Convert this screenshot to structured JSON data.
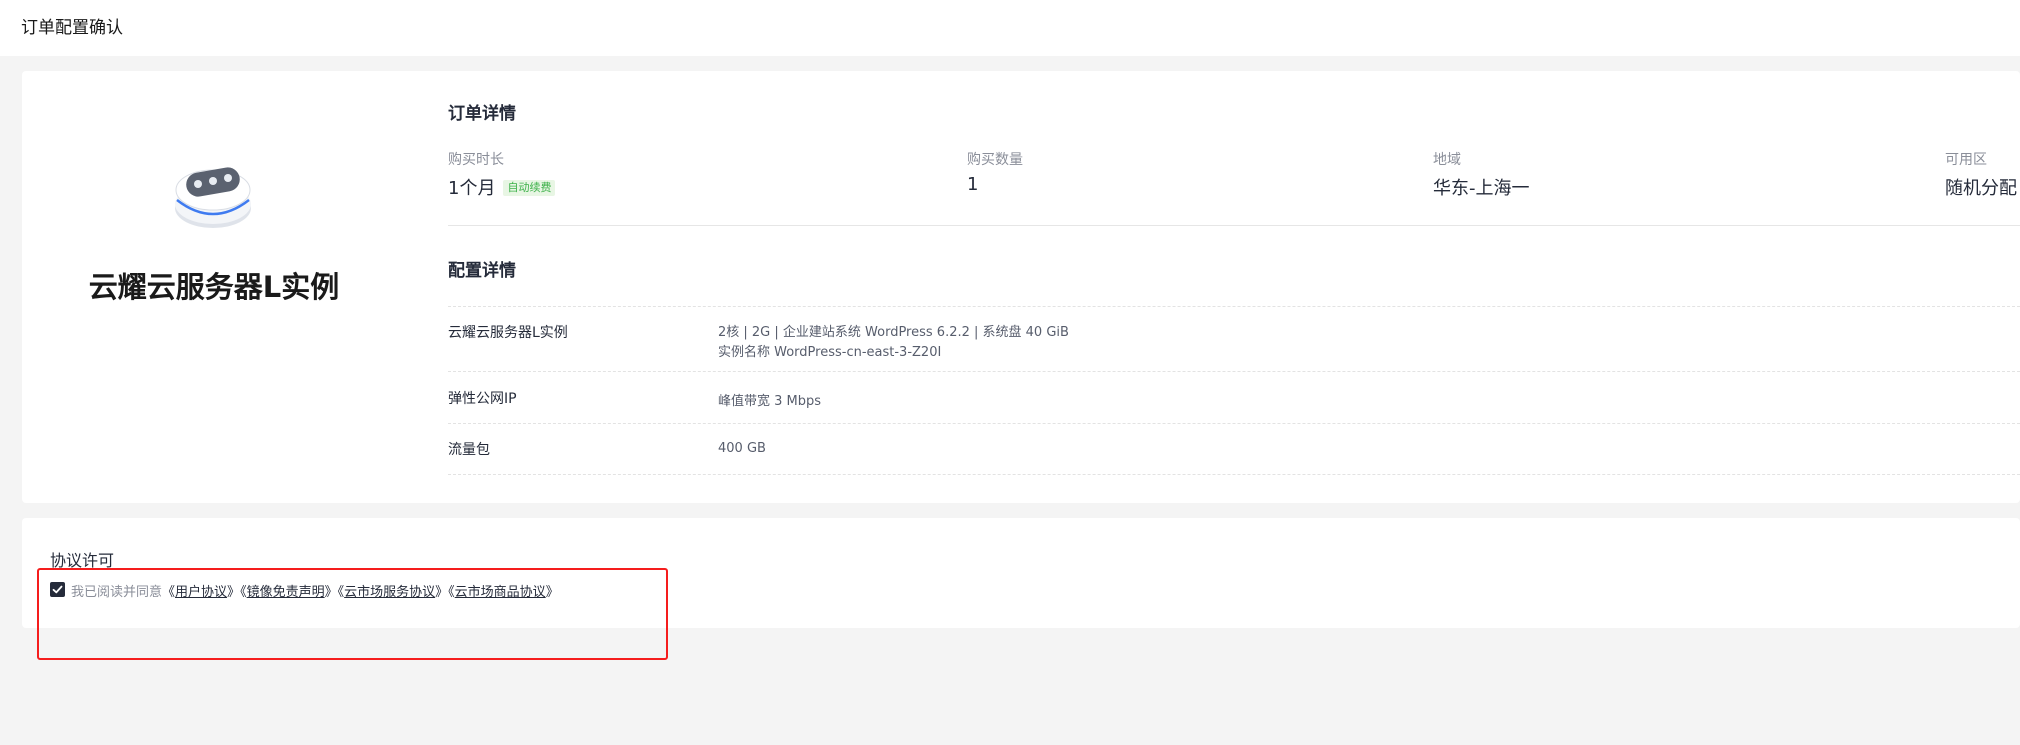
{
  "page": {
    "title": "订单配置确认"
  },
  "product": {
    "name": "云耀云服务器L实例",
    "icon": "server-box-icon"
  },
  "order": {
    "section_title": "订单详情",
    "duration_label": "购买时长",
    "duration_value": "1个月",
    "auto_renew_badge": "自动续费",
    "quantity_label": "购买数量",
    "quantity_value": "1",
    "region_label": "地域",
    "region_value": "华东-上海一",
    "zone_label": "可用区",
    "zone_value": "随机分配"
  },
  "config": {
    "section_title": "配置详情",
    "rows": [
      {
        "name": "云耀云服务器L实例",
        "line1": "2核 | 2G | 企业建站系统 WordPress 6.2.2 | 系统盘 40 GiB",
        "line2": "实例名称 WordPress-cn-east-3-Z20I"
      },
      {
        "name": "弹性公网IP",
        "line1": "峰值带宽 3 Mbps"
      },
      {
        "name": "流量包",
        "line1": "400 GB"
      }
    ]
  },
  "agreement": {
    "title": "协议许可",
    "checked": true,
    "prefix": "我已阅读并同意",
    "links": [
      "用户协议",
      "镜像免责声明",
      "云市场服务协议",
      "云市场商品协议"
    ],
    "open_bracket": "《",
    "close_bracket": "》"
  },
  "colors": {
    "highlight": "#f51d1d",
    "badge_text": "#3eb14a",
    "badge_bg": "#e8f6e4",
    "checkbox": "#252b3a"
  }
}
